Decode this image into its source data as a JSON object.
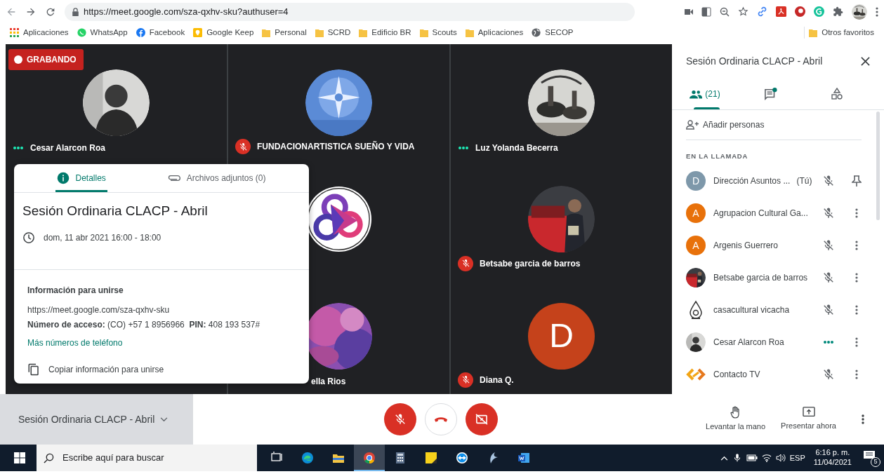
{
  "browser": {
    "url": "https://meet.google.com/sza-qxhv-sku?authuser=4",
    "bookmarks": [
      {
        "label": "Aplicaciones",
        "kind": "apps"
      },
      {
        "label": "WhatsApp",
        "kind": "whatsapp"
      },
      {
        "label": "Facebook",
        "kind": "facebook"
      },
      {
        "label": "Google Keep",
        "kind": "keep"
      },
      {
        "label": "Personal",
        "kind": "folder"
      },
      {
        "label": "SCRD",
        "kind": "folder"
      },
      {
        "label": "Edificio BR",
        "kind": "folder"
      },
      {
        "label": "Scouts",
        "kind": "folder"
      },
      {
        "label": "Aplicaciones",
        "kind": "folder"
      },
      {
        "label": "SECOP",
        "kind": "globe"
      }
    ],
    "other_bookmarks": "Otros favoritos"
  },
  "recording": {
    "label": "GRABANDO"
  },
  "grid": {
    "columns": [
      {
        "tiles": [
          {
            "name": "Cesar Alarcon Roa",
            "muted": false
          }
        ]
      },
      {
        "tiles": [
          {
            "name": "FUNDACIONARTISTICA SUEÑO Y VIDA",
            "muted": true
          },
          {
            "avatar": {
              "kind": "rings"
            }
          },
          {
            "name": "ella Rios"
          }
        ]
      },
      {
        "tiles": [
          {
            "name": "Luz Yolanda Becerra",
            "muted": false
          },
          {
            "name": "Betsabe garcia de barros",
            "muted": true
          },
          {
            "name": "Diana Q.",
            "muted": true,
            "avatar": {
              "kind": "letter",
              "letter": "D",
              "color": "#c5421b"
            }
          }
        ]
      }
    ]
  },
  "details": {
    "tabs": [
      {
        "label": "Detalles",
        "kind": "info",
        "selected": true
      },
      {
        "label": "Archivos adjuntos (0)",
        "kind": "attachment",
        "selected": false
      }
    ],
    "title": "Sesión Ordinaria CLACP - Abril",
    "when": "dom, 11 abr 2021 16:00 - 18:00",
    "join_heading": "Información para unirse",
    "join_url": "https://meet.google.com/sza-qxhv-sku",
    "access": "**Número de acceso:** (CO) +57 1 8956966  **PIN:** 408 193 537#",
    "more_numbers": "Más números de teléfono",
    "copy": "Copiar información para unirse"
  },
  "sidebar": {
    "title": "Sesión Ordinaria CLACP - Abril",
    "tabs": [
      {
        "kind": "people",
        "count": "(21)",
        "selected": true
      },
      {
        "kind": "chat",
        "unread": true,
        "selected": false
      },
      {
        "kind": "activities",
        "selected": false
      }
    ],
    "add_people": "Añadir personas",
    "section": "EN LA LLAMADA",
    "participants": [
      {
        "kind": "self",
        "name": "Dirección Asuntos ...",
        "suffix": "(Tú)",
        "avatar": {
          "kind": "letter",
          "letter": "D",
          "color": "#7e98aa"
        },
        "muted": true
      },
      {
        "kind": "other",
        "name": "Agrupacion Cultural Ga...",
        "avatar": {
          "kind": "letter",
          "letter": "A",
          "color": "#e8710a"
        },
        "muted": true
      },
      {
        "kind": "other",
        "name": "Argenis Guerrero",
        "avatar": {
          "kind": "letter",
          "letter": "A",
          "color": "#e8710a"
        },
        "muted": true
      },
      {
        "kind": "other",
        "name": "Betsabe garcia de barros",
        "muted": true
      },
      {
        "kind": "other",
        "name": "casacultural vicacha",
        "avatar": {
          "kind": "drop"
        },
        "muted": true
      },
      {
        "kind": "other",
        "name": "Cesar Alarcon Roa",
        "muted": false
      },
      {
        "kind": "other",
        "name": "Contacto TV",
        "avatar": {
          "kind": "chain"
        },
        "muted": true
      }
    ]
  },
  "meeting_bar": {
    "title": "Sesión Ordinaria CLACP - Abril",
    "mic_on": false,
    "camera_on": false,
    "actions": [
      {
        "label": "Levantar la mano",
        "kind": "hand"
      },
      {
        "label": "Presentar ahora",
        "kind": "present"
      }
    ]
  },
  "taskbar": {
    "search_placeholder": "Escribe aquí para buscar",
    "apps": [
      {
        "kind": "taskview",
        "selected": false
      },
      {
        "kind": "edge",
        "selected": false
      },
      {
        "kind": "explorer",
        "selected": false
      },
      {
        "kind": "chrome",
        "selected": true
      },
      {
        "kind": "calculator",
        "selected": false
      },
      {
        "kind": "sticky",
        "selected": false
      },
      {
        "kind": "teamviewer",
        "selected": false
      },
      {
        "kind": "swoosh",
        "selected": false
      },
      {
        "kind": "word",
        "selected": false
      }
    ],
    "language": "ESP",
    "time": "6:16 p. m.",
    "date": "11/04/2021",
    "notifications": "5"
  }
}
